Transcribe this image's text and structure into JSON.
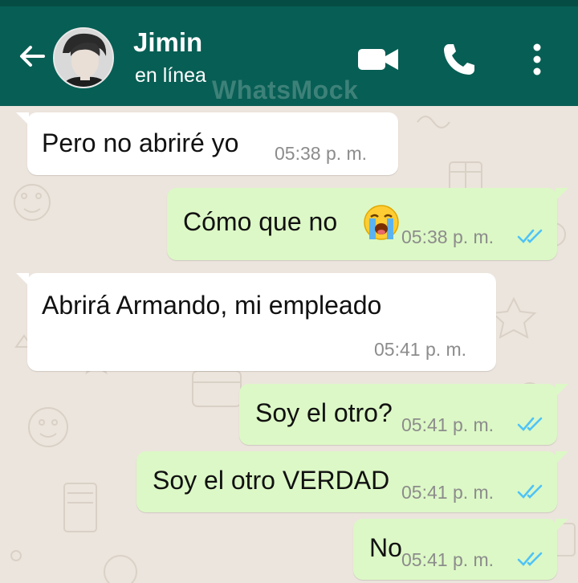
{
  "header": {
    "contact_name": "Jimin",
    "status": "en línea",
    "watermark": "WhatsMock",
    "accent_color": "#075e54"
  },
  "icons": {
    "back": "arrow-left-icon",
    "video": "video-call-icon",
    "call": "phone-icon",
    "menu": "more-vert-icon"
  },
  "messages": [
    {
      "direction": "in",
      "text": "Pero no abriré yo",
      "time": "05:38 p. m."
    },
    {
      "direction": "out",
      "text": "Cómo que no",
      "emoji": "loudly-crying-face",
      "time": "05:38 p. m.",
      "read": true
    },
    {
      "direction": "in",
      "text": "Abrirá Armando, mi empleado",
      "time": "05:41 p. m."
    },
    {
      "direction": "out",
      "text": "Soy el otro?",
      "time": "05:41 p. m.",
      "read": true
    },
    {
      "direction": "out",
      "text": "Soy el otro VERDAD",
      "time": "05:41 p. m.",
      "read": true
    },
    {
      "direction": "out",
      "text": "No",
      "time": "05:41 p. m.",
      "read": true
    }
  ],
  "colors": {
    "incoming_bubble": "#ffffff",
    "outgoing_bubble": "#dcf8c6",
    "read_ticks": "#4fc3f7",
    "wallpaper": "#ece5dd"
  }
}
